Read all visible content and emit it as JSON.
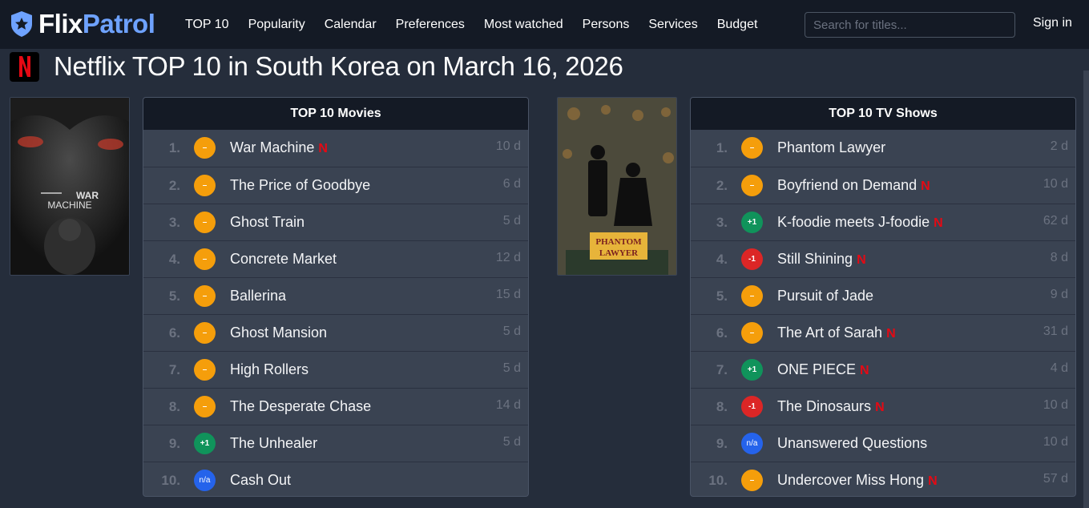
{
  "header": {
    "logo_part1": "Flix",
    "logo_part2": "Patrol",
    "nav": [
      "TOP 10",
      "Popularity",
      "Calendar",
      "Preferences",
      "Most watched",
      "Persons",
      "Services",
      "Budget"
    ],
    "search_placeholder": "Search for titles...",
    "sign_in": "Sign in"
  },
  "page": {
    "title": "Netflix TOP 10 in South Korea on March 16, 2026"
  },
  "colors": {
    "same": "#f59e0b",
    "up": "#10935b",
    "down": "#dc2626",
    "new": "#2563eb",
    "netflix_red": "#e50914",
    "logo_blue": "#6ea2ff"
  },
  "movies": {
    "heading": "TOP 10 Movies",
    "poster_text": [
      "WAR",
      "MACHINE"
    ],
    "rows": [
      {
        "rank": "1.",
        "change": "–",
        "change_type": "same",
        "title": "War Machine",
        "netflix": true,
        "days": "10 d"
      },
      {
        "rank": "2.",
        "change": "–",
        "change_type": "same",
        "title": "The Price of Goodbye",
        "netflix": false,
        "days": "6 d"
      },
      {
        "rank": "3.",
        "change": "–",
        "change_type": "same",
        "title": "Ghost Train",
        "netflix": false,
        "days": "5 d"
      },
      {
        "rank": "4.",
        "change": "–",
        "change_type": "same",
        "title": "Concrete Market",
        "netflix": false,
        "days": "12 d"
      },
      {
        "rank": "5.",
        "change": "–",
        "change_type": "same",
        "title": "Ballerina",
        "netflix": false,
        "days": "15 d"
      },
      {
        "rank": "6.",
        "change": "–",
        "change_type": "same",
        "title": "Ghost Mansion",
        "netflix": false,
        "days": "5 d"
      },
      {
        "rank": "7.",
        "change": "–",
        "change_type": "same",
        "title": "High Rollers",
        "netflix": false,
        "days": "5 d"
      },
      {
        "rank": "8.",
        "change": "–",
        "change_type": "same",
        "title": "The Desperate Chase",
        "netflix": false,
        "days": "14 d"
      },
      {
        "rank": "9.",
        "change": "+1",
        "change_type": "up",
        "title": "The Unhealer",
        "netflix": false,
        "days": "5 d"
      },
      {
        "rank": "10.",
        "change": "n/a",
        "change_type": "na",
        "title": "Cash Out",
        "netflix": false,
        "days": ""
      }
    ]
  },
  "tv": {
    "heading": "TOP 10 TV Shows",
    "poster_text": [
      "PHANTOM",
      "LAWYER"
    ],
    "rows": [
      {
        "rank": "1.",
        "change": "–",
        "change_type": "same",
        "title": "Phantom Lawyer",
        "netflix": false,
        "days": "2 d"
      },
      {
        "rank": "2.",
        "change": "–",
        "change_type": "same",
        "title": "Boyfriend on Demand",
        "netflix": true,
        "days": "10 d"
      },
      {
        "rank": "3.",
        "change": "+1",
        "change_type": "up",
        "title": "K-foodie meets J-foodie",
        "netflix": true,
        "days": "62 d"
      },
      {
        "rank": "4.",
        "change": "-1",
        "change_type": "down",
        "title": "Still Shining",
        "netflix": true,
        "days": "8 d"
      },
      {
        "rank": "5.",
        "change": "–",
        "change_type": "same",
        "title": "Pursuit of Jade",
        "netflix": false,
        "days": "9 d"
      },
      {
        "rank": "6.",
        "change": "–",
        "change_type": "same",
        "title": "The Art of Sarah",
        "netflix": true,
        "days": "31 d"
      },
      {
        "rank": "7.",
        "change": "+1",
        "change_type": "up",
        "title": "ONE PIECE",
        "netflix": true,
        "days": "4 d"
      },
      {
        "rank": "8.",
        "change": "-1",
        "change_type": "down",
        "title": "The Dinosaurs",
        "netflix": true,
        "days": "10 d"
      },
      {
        "rank": "9.",
        "change": "n/a",
        "change_type": "na",
        "title": "Unanswered Questions",
        "netflix": false,
        "days": "10 d"
      },
      {
        "rank": "10.",
        "change": "–",
        "change_type": "same",
        "title": "Undercover Miss Hong",
        "netflix": true,
        "days": "57 d"
      }
    ]
  }
}
